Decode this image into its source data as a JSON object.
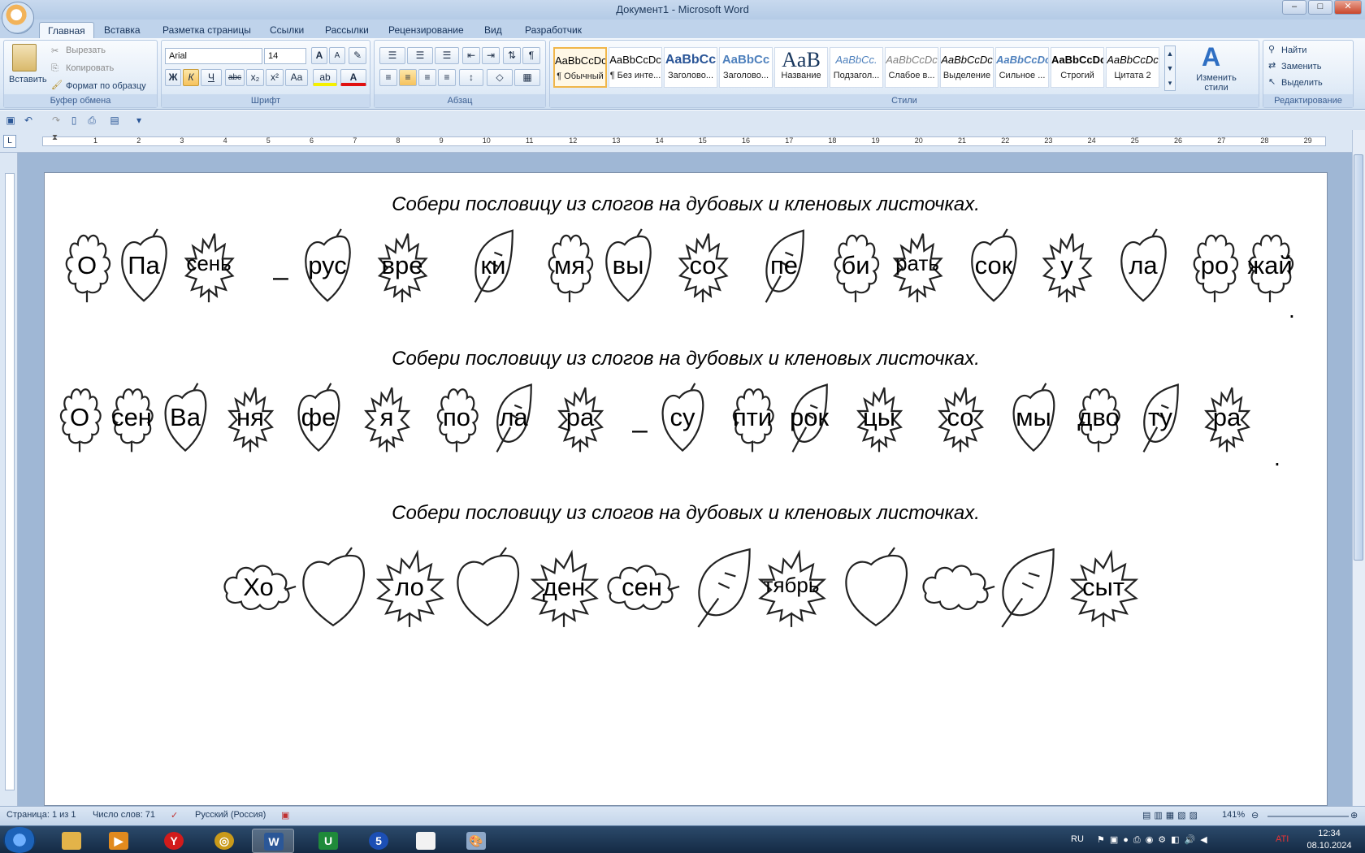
{
  "window": {
    "title": "Документ1 - Microsoft Word",
    "minimize": "–",
    "maximize": "□",
    "close": "✕"
  },
  "tabs": [
    "Главная",
    "Вставка",
    "Разметка страницы",
    "Ссылки",
    "Рассылки",
    "Рецензирование",
    "Вид",
    "Разработчик"
  ],
  "clipboard": {
    "paste": "Вставить",
    "cut": "Вырезать",
    "copy": "Копировать",
    "format_painter": "Формат по образцу",
    "label": "Буфер обмена"
  },
  "font": {
    "name": "Arial",
    "size": "14",
    "bold": "Ж",
    "italic": "К",
    "underline": "Ч",
    "strike": "abc",
    "sub": "x₂",
    "sup": "x²",
    "case": "Aa",
    "grow": "A",
    "shrink": "A",
    "label": "Шрифт"
  },
  "paragraph": {
    "label": "Абзац",
    "pilcrow": "¶"
  },
  "styles": {
    "label": "Стили",
    "items": [
      {
        "sample": "AaBbCcDc",
        "name": "¶ Обычный"
      },
      {
        "sample": "AaBbCcDc",
        "name": "¶ Без инте..."
      },
      {
        "sample": "AaBbCc",
        "name": "Заголово..."
      },
      {
        "sample": "AaBbCc",
        "name": "Заголово..."
      },
      {
        "sample": "AaB",
        "name": "Название"
      },
      {
        "sample": "AaBbCc.",
        "name": "Подзагол..."
      },
      {
        "sample": "AaBbCcDc",
        "name": "Слабое в..."
      },
      {
        "sample": "AaBbCcDc",
        "name": "Выделение"
      },
      {
        "sample": "AaBbCcDc",
        "name": "Сильное ..."
      },
      {
        "sample": "AaBbCcDc",
        "name": "Строгий"
      },
      {
        "sample": "AaBbCcDc",
        "name": "Цитата 2"
      }
    ],
    "change": "Изменить стили"
  },
  "editing": {
    "find": "Найти",
    "replace": "Заменить",
    "select": "Выделить",
    "label": "Редактирование"
  },
  "ruler": [
    "1",
    "2",
    "3",
    "4",
    "5",
    "6",
    "7",
    "8",
    "9",
    "10",
    "11",
    "12",
    "13",
    "14",
    "15",
    "16",
    "17",
    "18",
    "19",
    "20",
    "21",
    "22",
    "23",
    "24",
    "25",
    "26",
    "27",
    "28",
    "29"
  ],
  "document": {
    "heading1": "Собери пословицу из слогов на дубовых и кленовых листочках.",
    "heading2": "Собери пословицу из слогов на дубовых и кленовых листочках.",
    "heading3": "Собери пословицу из слогов на дубовых и кленовых листочках.",
    "row1": [
      "О",
      "Па",
      "сень",
      "рус",
      "вре",
      "ки",
      "мя",
      "вы",
      "со",
      "пе",
      "би",
      "рать",
      "сок",
      "у",
      "ла",
      "ро",
      "жай"
    ],
    "row2": [
      "О",
      "сен",
      "Ва",
      "ня",
      "фе",
      "я",
      "по",
      "ла",
      "ра",
      "су",
      "пти",
      "рок",
      "цы",
      "со",
      "мы",
      "дво",
      "ту",
      "ра"
    ],
    "row3": [
      "Хо",
      "",
      "ло",
      "",
      "ден",
      "сен",
      "",
      "тябрь",
      "",
      "",
      "",
      "сыт"
    ],
    "dash": "–",
    "period": "."
  },
  "status": {
    "page": "Страница: 1 из 1",
    "words": "Число слов: 71",
    "language": "Русский (Россия)",
    "zoom": "141%"
  },
  "tray": {
    "lang": "RU",
    "time": "12:34",
    "date": "08.10.2024"
  }
}
